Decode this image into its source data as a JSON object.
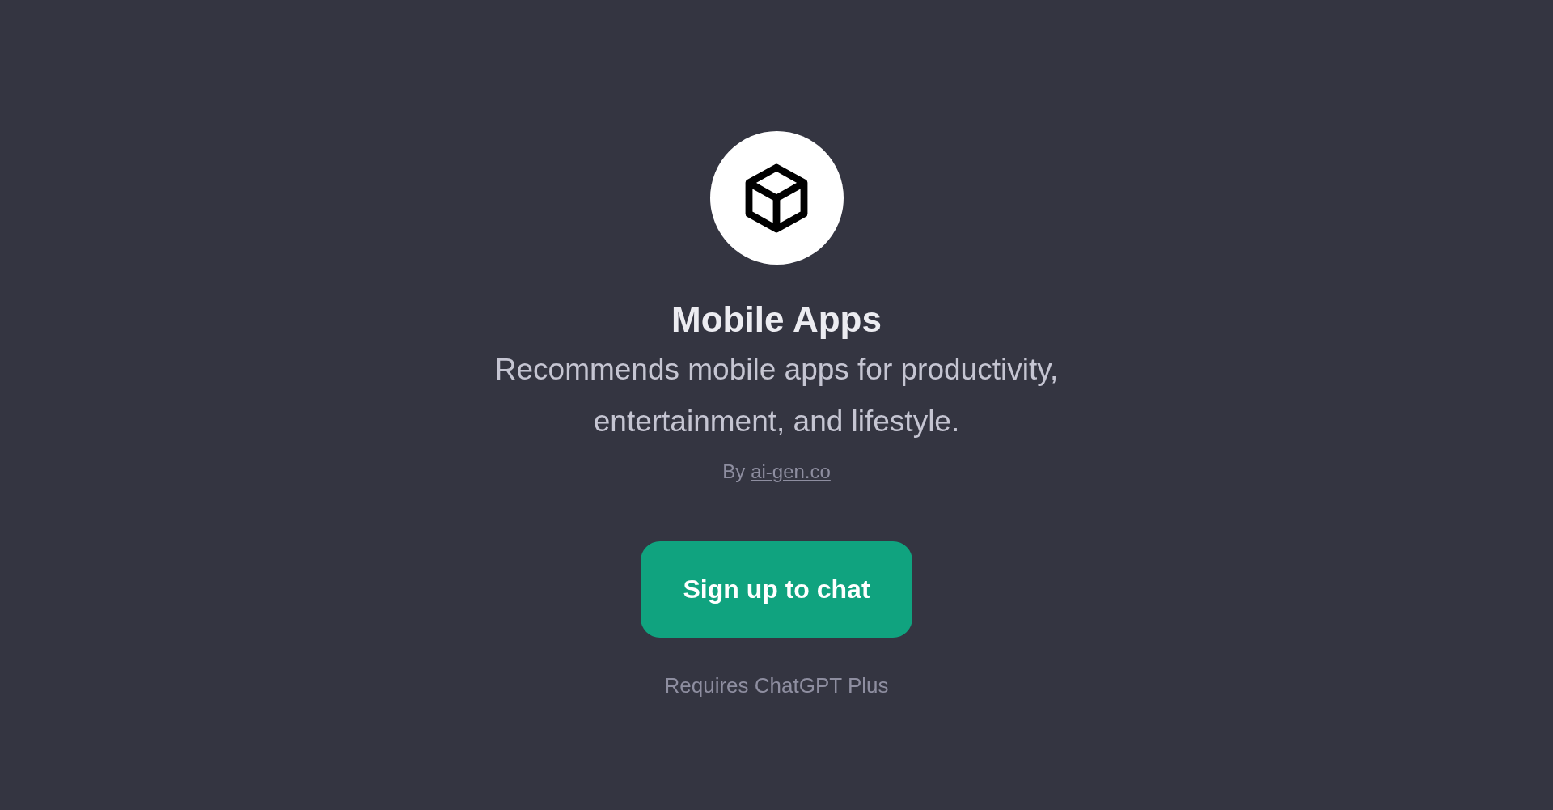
{
  "gpt": {
    "title": "Mobile Apps",
    "description": "Recommends mobile apps for productivity, entertainment, and lifestyle.",
    "author_prefix": "By",
    "author_link": "ai-gen.co"
  },
  "button": {
    "label": "Sign up to chat"
  },
  "note": "Requires ChatGPT Plus"
}
